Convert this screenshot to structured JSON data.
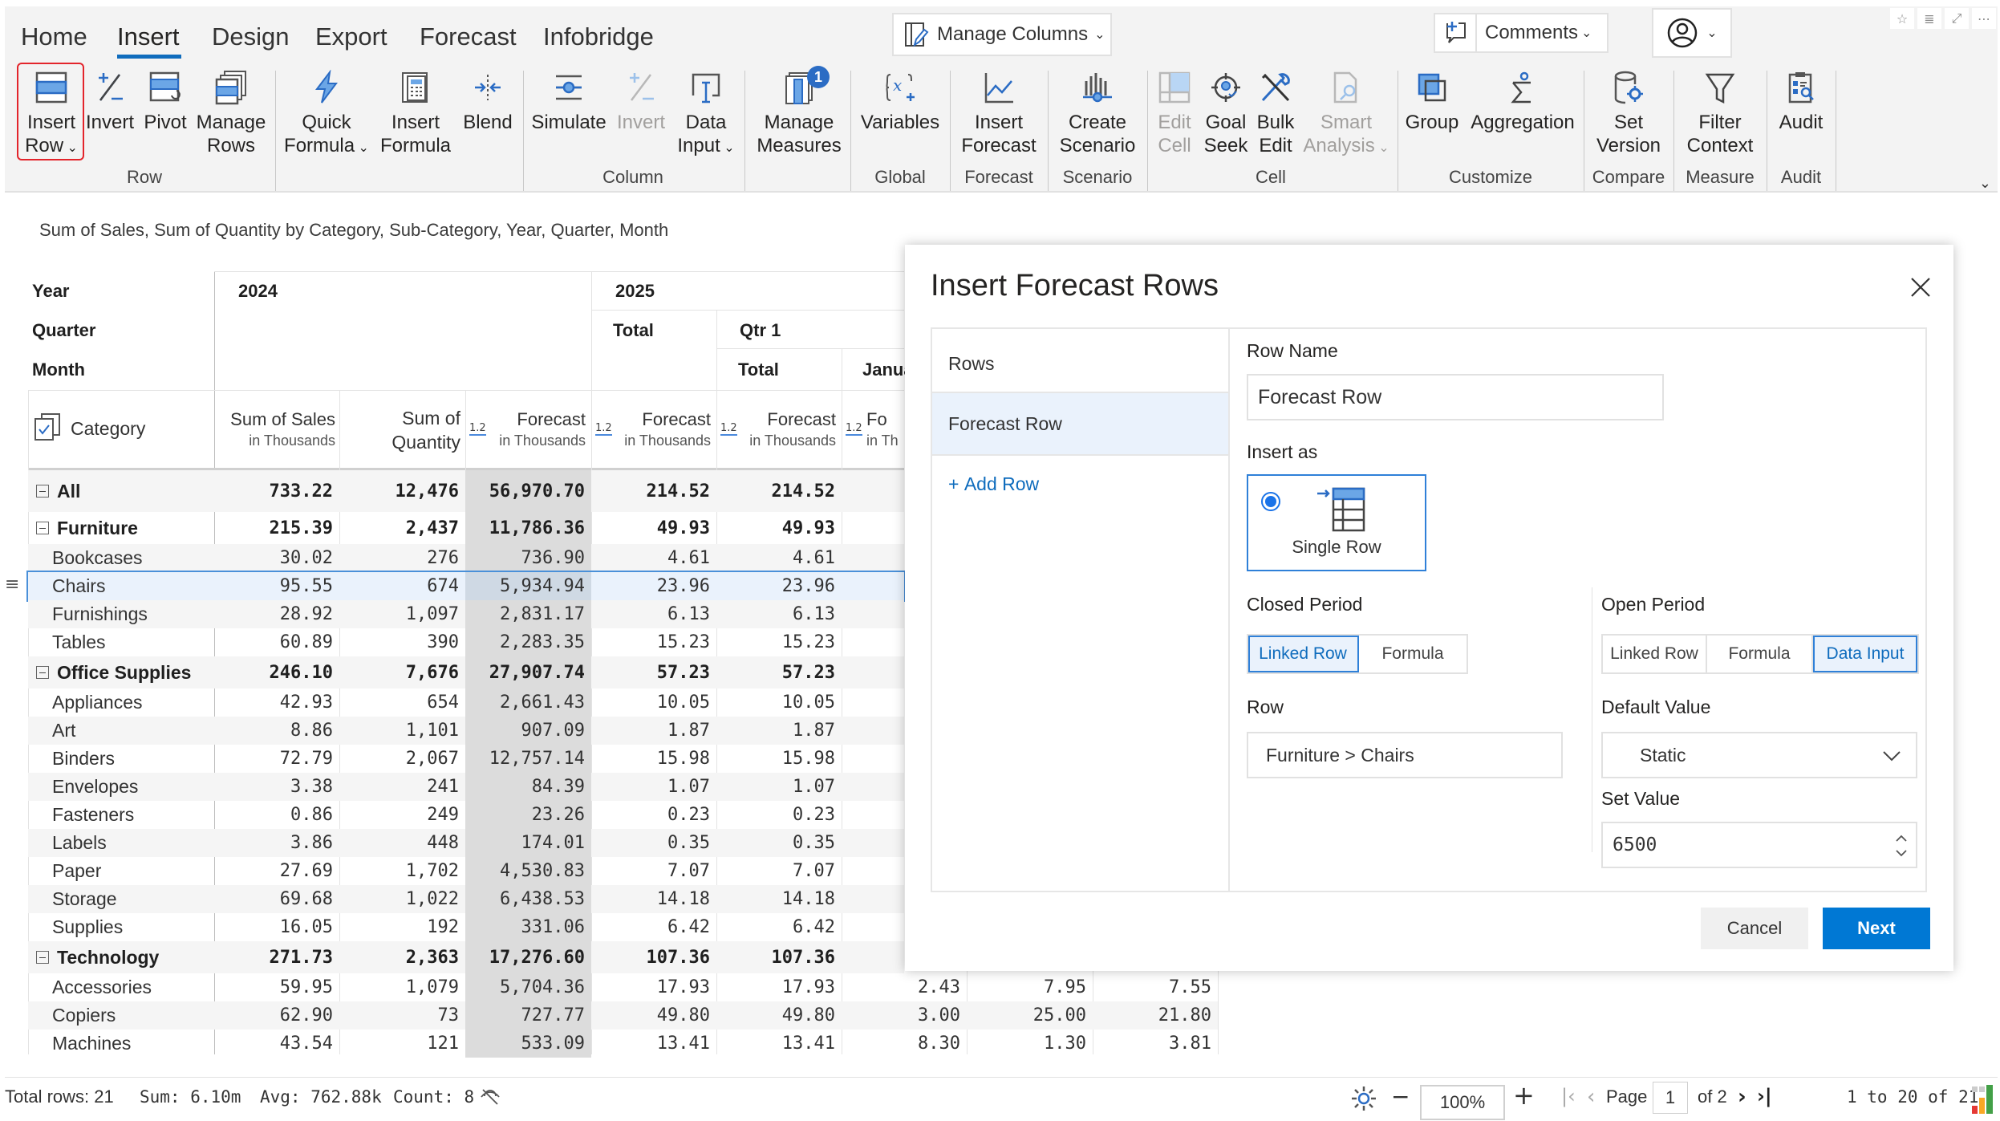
{
  "ribbon": {
    "tabs": [
      {
        "label": "Home",
        "active": false
      },
      {
        "label": "Insert",
        "active": true
      },
      {
        "label": "Design",
        "active": false
      },
      {
        "label": "Export",
        "active": false
      },
      {
        "label": "Forecast",
        "active": false
      },
      {
        "label": "Infobridge",
        "active": false
      }
    ],
    "manage_columns": "Manage Columns",
    "comments": "Comments",
    "measures_badge": "1",
    "buttons": {
      "insert_row": [
        "Insert",
        "Row"
      ],
      "invert": [
        "Invert"
      ],
      "pivot": [
        "Pivot"
      ],
      "manage_rows": [
        "Manage",
        "Rows"
      ],
      "quick_formula": [
        "Quick",
        "Formula"
      ],
      "insert_formula": [
        "Insert",
        "Formula"
      ],
      "blend": [
        "Blend"
      ],
      "simulate": [
        "Simulate"
      ],
      "invert_col": [
        "Invert"
      ],
      "data_input": [
        "Data",
        "Input"
      ],
      "manage_measures": [
        "Manage",
        "Measures"
      ],
      "variables": [
        "Variables"
      ],
      "insert_forecast": [
        "Insert",
        "Forecast"
      ],
      "create_scenario": [
        "Create",
        "Scenario"
      ],
      "edit_cell": [
        "Edit",
        "Cell"
      ],
      "goal_seek": [
        "Goal",
        "Seek"
      ],
      "bulk_edit": [
        "Bulk",
        "Edit"
      ],
      "smart_analysis": [
        "Smart",
        "Analysis"
      ],
      "group": [
        "Group"
      ],
      "aggregation": [
        "Aggregation"
      ],
      "set_version": [
        "Set",
        "Version"
      ],
      "filter_context": [
        "Filter",
        "Context"
      ],
      "audit": [
        "Audit"
      ]
    },
    "groups": {
      "row": "Row",
      "column": "Column",
      "global": "Global",
      "forecast": "Forecast",
      "scenario": "Scenario",
      "cell": "Cell",
      "customize": "Customize",
      "compare": "Compare",
      "measure": "Measure",
      "audit": "Audit"
    }
  },
  "subtitle": "Sum of Sales, Sum of Quantity by Category, Sub-Category, Year, Quarter, Month",
  "table": {
    "header_labels": {
      "year": "Year",
      "quarter": "Quarter",
      "month": "Month",
      "category": "Category"
    },
    "year_2024": "2024",
    "year_2025": "2025",
    "quarter_total": "Total",
    "qtr1": "Qtr 1",
    "month_total": "Total",
    "month_jan": "Janua",
    "measures": [
      {
        "name": "Sum of Sales",
        "sub": "in Thousands"
      },
      {
        "name": "Sum of",
        "sub": "Quantity"
      },
      {
        "name": "Forecast",
        "sub": "in Thousands"
      },
      {
        "name": "Forecast",
        "sub": "in Thousands"
      },
      {
        "name": "Forecast",
        "sub": "in Thousands"
      },
      {
        "name": "Fo",
        "sub": "in Th"
      }
    ],
    "num_icon": "1.2",
    "rows": [
      {
        "label": "All",
        "level": 0,
        "bold": true,
        "values": [
          "733.22",
          "12,476",
          "56,970.70",
          "214.52",
          "214.52",
          "",
          "",
          ""
        ]
      },
      {
        "label": "Furniture",
        "level": 0,
        "bold": true,
        "values": [
          "215.39",
          "2,437",
          "11,786.36",
          "49.93",
          "49.93",
          "",
          "",
          ""
        ]
      },
      {
        "label": "Bookcases",
        "level": 1,
        "bold": false,
        "values": [
          "30.02",
          "276",
          "736.90",
          "4.61",
          "4.61",
          "",
          "",
          ""
        ]
      },
      {
        "label": "Chairs",
        "level": 1,
        "bold": false,
        "selected": true,
        "values": [
          "95.55",
          "674",
          "5,934.94",
          "23.96",
          "23.96",
          "",
          "",
          ""
        ]
      },
      {
        "label": "Furnishings",
        "level": 1,
        "bold": false,
        "values": [
          "28.92",
          "1,097",
          "2,831.17",
          "6.13",
          "6.13",
          "",
          "",
          ""
        ]
      },
      {
        "label": "Tables",
        "level": 1,
        "bold": false,
        "values": [
          "60.89",
          "390",
          "2,283.35",
          "15.23",
          "15.23",
          "",
          "",
          ""
        ]
      },
      {
        "label": "Office Supplies",
        "level": 0,
        "bold": true,
        "values": [
          "246.10",
          "7,676",
          "27,907.74",
          "57.23",
          "57.23",
          "",
          "",
          ""
        ]
      },
      {
        "label": "Appliances",
        "level": 1,
        "bold": false,
        "values": [
          "42.93",
          "654",
          "2,661.43",
          "10.05",
          "10.05",
          "",
          "",
          ""
        ]
      },
      {
        "label": "Art",
        "level": 1,
        "bold": false,
        "values": [
          "8.86",
          "1,101",
          "907.09",
          "1.87",
          "1.87",
          "",
          "",
          ""
        ]
      },
      {
        "label": "Binders",
        "level": 1,
        "bold": false,
        "values": [
          "72.79",
          "2,067",
          "12,757.14",
          "15.98",
          "15.98",
          "",
          "",
          ""
        ]
      },
      {
        "label": "Envelopes",
        "level": 1,
        "bold": false,
        "values": [
          "3.38",
          "241",
          "84.39",
          "1.07",
          "1.07",
          "",
          "",
          ""
        ]
      },
      {
        "label": "Fasteners",
        "level": 1,
        "bold": false,
        "values": [
          "0.86",
          "249",
          "23.26",
          "0.23",
          "0.23",
          "",
          "",
          ""
        ]
      },
      {
        "label": "Labels",
        "level": 1,
        "bold": false,
        "values": [
          "3.86",
          "448",
          "174.01",
          "0.35",
          "0.35",
          "",
          "",
          ""
        ]
      },
      {
        "label": "Paper",
        "level": 1,
        "bold": false,
        "values": [
          "27.69",
          "1,702",
          "4,530.83",
          "7.07",
          "7.07",
          "",
          "",
          ""
        ]
      },
      {
        "label": "Storage",
        "level": 1,
        "bold": false,
        "values": [
          "69.68",
          "1,022",
          "6,438.53",
          "14.18",
          "14.18",
          "",
          "",
          ""
        ]
      },
      {
        "label": "Supplies",
        "level": 1,
        "bold": false,
        "values": [
          "16.05",
          "192",
          "331.06",
          "6.42",
          "6.42",
          "",
          "",
          ""
        ]
      },
      {
        "label": "Technology",
        "level": 0,
        "bold": true,
        "values": [
          "271.73",
          "2,363",
          "17,276.60",
          "107.36",
          "107.36",
          "",
          "",
          ""
        ]
      },
      {
        "label": "Accessories",
        "level": 1,
        "bold": false,
        "values": [
          "59.95",
          "1,079",
          "5,704.36",
          "17.93",
          "17.93",
          "2.43",
          "7.95",
          "7.55"
        ]
      },
      {
        "label": "Copiers",
        "level": 1,
        "bold": false,
        "values": [
          "62.90",
          "73",
          "727.77",
          "49.80",
          "49.80",
          "3.00",
          "25.00",
          "21.80"
        ]
      },
      {
        "label": "Machines",
        "level": 1,
        "bold": false,
        "values": [
          "43.54",
          "121",
          "533.09",
          "13.41",
          "13.41",
          "8.30",
          "1.30",
          "3.81"
        ]
      }
    ]
  },
  "dialog": {
    "title": "Insert Forecast Rows",
    "rows_header": "Rows",
    "rows_items": [
      "Forecast Row"
    ],
    "add_row": "Add Row",
    "row_name_label": "Row Name",
    "row_name_value": "Forecast Row",
    "insert_as_label": "Insert as",
    "insert_as_option": "Single Row",
    "closed_period_label": "Closed Period",
    "closed_period_options": [
      {
        "label": "Linked Row",
        "selected": true
      },
      {
        "label": "Formula",
        "selected": false
      }
    ],
    "row_label": "Row",
    "row_value": "Furniture > Chairs",
    "open_period_label": "Open Period",
    "open_period_options": [
      {
        "label": "Linked Row",
        "selected": false
      },
      {
        "label": "Formula",
        "selected": false
      },
      {
        "label": "Data Input",
        "selected": true
      }
    ],
    "default_value_label": "Default Value",
    "default_value": "Static",
    "set_value_label": "Set Value",
    "set_value": "6500",
    "cancel": "Cancel",
    "next": "Next"
  },
  "status": {
    "total_rows": "Total rows: 21",
    "sum": "Sum: 6.10m",
    "avg": "Avg: 762.88k",
    "count": "Count: 8",
    "zoom": "100%",
    "page_label": "Page",
    "page": "1",
    "of_pages": "of 2",
    "range": "1 to 20 of 21"
  },
  "colors": {
    "accent": "#0f6cbd",
    "primary_button": "#0078d4",
    "highlight_border": "#e3242b",
    "selection_bg": "#eaf2fc"
  }
}
